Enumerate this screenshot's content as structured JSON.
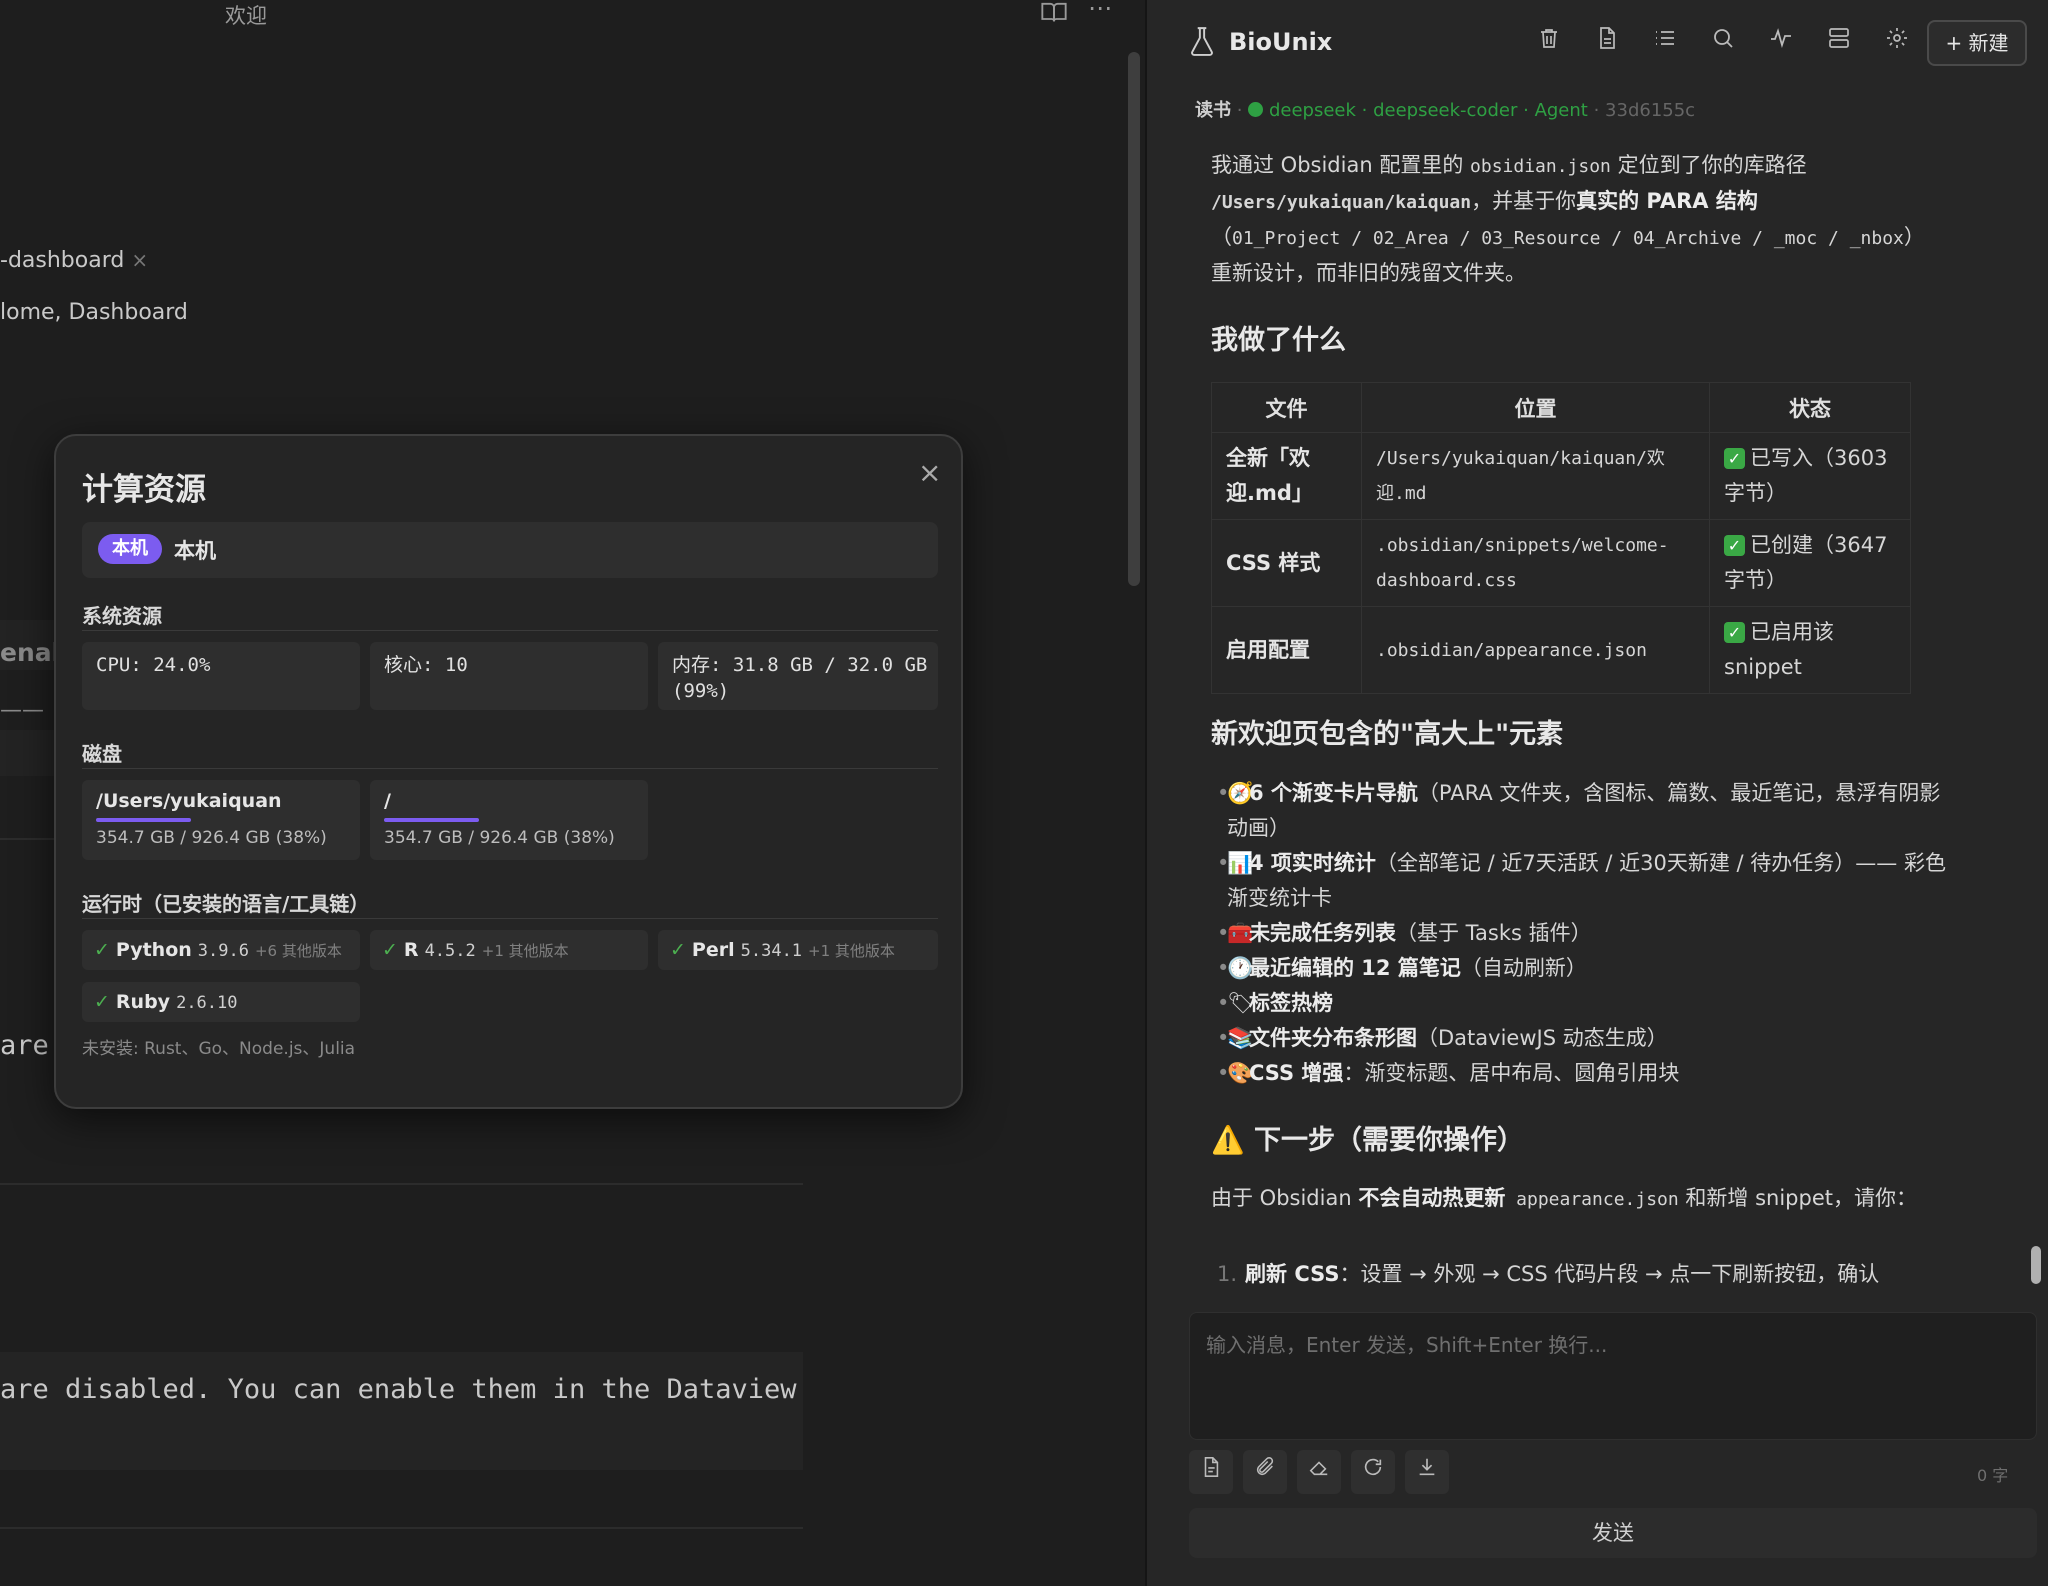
{
  "editor": {
    "tab_title": "欢迎",
    "prop_tags": "-dashboard",
    "prop_tags_remove": "×",
    "prop_aliases": "lome, Dashboard",
    "frag_enab": "enab",
    "frag_dash": "——",
    "frag_are": "are",
    "code_text": "are disabled. You can enable them in the Dataview"
  },
  "modal": {
    "title": "计算资源",
    "close": "×",
    "host_badge": "本机",
    "host_name": "本机",
    "sys_title": "系统资源",
    "cpu": "CPU: 24.0%",
    "cores": "核心: 10",
    "memory": "内存: 31.8 GB / 32.0 GB (99%)",
    "disk_title": "磁盘",
    "disks": [
      {
        "name": "/Users/yukaiquan",
        "size": "354.7 GB / 926.4 GB (38%)",
        "usage": 0.38
      },
      {
        "name": "/",
        "size": "354.7 GB / 926.4 GB (38%)",
        "usage": 0.38
      }
    ],
    "runtime_title": "运行时（已安装的语言/工具链）",
    "runtimes": [
      {
        "check": "✓",
        "name": "Python",
        "version": "3.9.6",
        "others": "+6 其他版本"
      },
      {
        "check": "✓",
        "name": "R",
        "version": "4.5.2",
        "others": "+1 其他版本"
      },
      {
        "check": "✓",
        "name": "Perl",
        "version": "5.34.1",
        "others": "+1 其他版本"
      },
      {
        "check": "✓",
        "name": "Ruby",
        "version": "2.6.10",
        "others": ""
      }
    ],
    "not_installed": "未安装: Rust、Go、Node.js、Julia"
  },
  "panel": {
    "app_title": "BioUnix",
    "new_button": "+ 新建",
    "status": {
      "book": "读书",
      "sep": "·",
      "provider": "deepseek",
      "model": "deepseek-coder",
      "mode": "Agent",
      "hash": "33d6155c"
    },
    "msg": {
      "p1a": "我通过 Obsidian 配置里的 ",
      "p1code": "obsidian.json",
      "p1b": " 定位到了你的库路径",
      "p1path": "/Users/yukaiquan/kaiquan",
      "p1c": "，并基于你",
      "p1bold": "真实的 PARA 结构",
      "p1paren_open": "（",
      "p1dirs": "01_Project / 02_Area / 03_Resource / 04_Archive / _moc / _nbox",
      "p1paren_close": "）",
      "p1d": "重新设计，而非旧的残留文件夹。"
    },
    "h_done": "我做了什么",
    "table": {
      "headers": [
        "文件",
        "位置",
        "状态"
      ],
      "rows": [
        {
          "file": "全新「欢迎.md」",
          "loc": "/Users/yukaiquan/kaiquan/欢迎.md",
          "status": "已写入（3603 字节）"
        },
        {
          "file": "CSS 样式",
          "loc": ".obsidian/snippets/welcome-dashboard.css",
          "status": "已创建（3647 字节）"
        },
        {
          "file": "启用配置",
          "loc": ".obsidian/appearance.json",
          "status": "已启用该 snippet"
        }
      ],
      "check": "✓"
    },
    "h_elements": "新欢迎页包含的\"高大上\"元素",
    "bullets": [
      {
        "emoji": "🧭",
        "bold": "6 个渐变卡片导航",
        "rest": "（PARA 文件夹，含图标、篇数、最近笔记，悬浮有阴影动画）"
      },
      {
        "emoji": "📊",
        "bold": "4 项实时统计",
        "rest": "（全部笔记 / 近7天活跃 / 近30天新建 / 待办任务）—— 彩色渐变统计卡"
      },
      {
        "emoji": "🧰",
        "bold": "未完成任务列表",
        "rest": "（基于 Tasks 插件）"
      },
      {
        "emoji": "🕐",
        "bold": "最近编辑的 12 篇笔记",
        "rest": "（自动刷新）"
      },
      {
        "emoji": "🏷",
        "bold": "标签热榜",
        "rest": ""
      },
      {
        "emoji": "📚",
        "bold": "文件夹分布条形图",
        "rest": "（DataviewJS 动态生成）"
      },
      {
        "emoji": "🎨",
        "bold": "CSS 增强",
        "rest": "：渐变标题、居中布局、圆角引用块"
      }
    ],
    "h_next": "⚠️ 下一步（需要你操作）",
    "next_a": "由于 Obsidian ",
    "next_bold": "不会自动热更新",
    "next_code": " appearance.json",
    "next_b": " 和新增 snippet，请你：",
    "step1_num": "1.",
    "step1_bold": "刷新 CSS",
    "step1_rest": "：设置 → 外观 → CSS 代码片段 → 点一下刷新按钮，确认",
    "input_placeholder": "输入消息，Enter 发送，Shift+Enter 换行...",
    "word_count": "0 字",
    "send_label": "发送"
  },
  "icons": {
    "header": [
      "trash-icon",
      "document-icon",
      "list-icon",
      "search-icon",
      "activity-icon",
      "layout-icon",
      "gear-icon"
    ],
    "toolbar": [
      "file-icon",
      "paperclip-icon",
      "eraser-icon",
      "refresh-icon",
      "download-icon"
    ]
  },
  "colors": {
    "accent": "#7c5cf0",
    "success": "#2ea043",
    "check_box": "#3aa845"
  }
}
